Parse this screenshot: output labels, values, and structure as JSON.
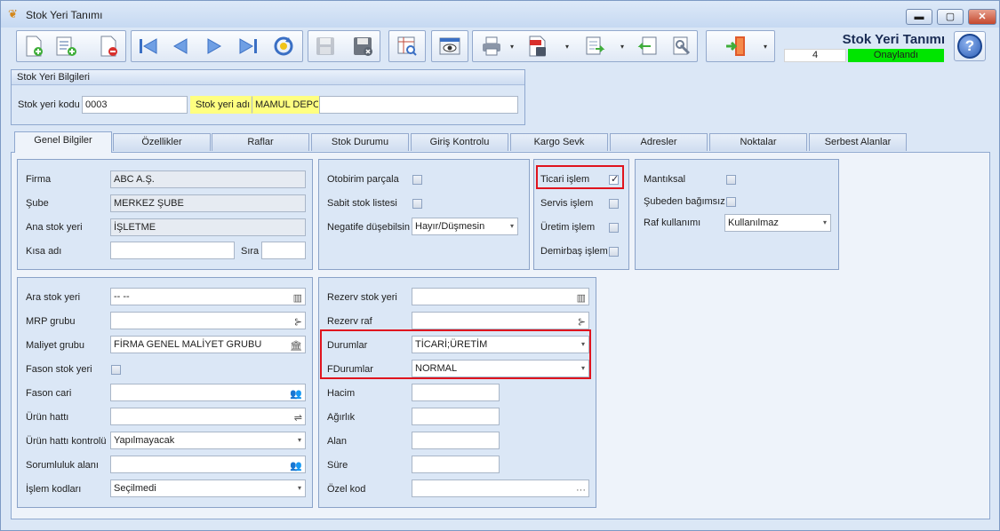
{
  "window": {
    "title": "Stok Yeri Tanımı",
    "controls": {
      "minimize": "▬",
      "maximize": "▢",
      "close": "✕"
    }
  },
  "toolbar": {
    "app_title": "Stok Yeri Tanımı",
    "record_number": "4",
    "status": "Onaylandı",
    "status_color": "#00e500",
    "help_label": "?"
  },
  "header_group": {
    "title": "Stok Yeri Bilgileri",
    "code_label": "Stok yeri kodu",
    "code_value": "0003",
    "name_label": "Stok yeri adı",
    "name_value": "MAMUL DEPO"
  },
  "tabs": [
    {
      "label": "Genel Bilgiler"
    },
    {
      "label": "Özellikler"
    },
    {
      "label": "Raflar"
    },
    {
      "label": "Stok Durumu"
    },
    {
      "label": "Giriş Kontrolu"
    },
    {
      "label": "Kargo Sevk"
    },
    {
      "label": "Adresler"
    },
    {
      "label": "Noktalar"
    },
    {
      "label": "Serbest Alanlar"
    }
  ],
  "general": {
    "firma_label": "Firma",
    "firma_value": "ABC A.Ş.",
    "sube_label": "Şube",
    "sube_value": "MERKEZ ŞUBE",
    "ana_label": "Ana stok yeri",
    "ana_value": "İŞLETME",
    "kisa_label": "Kısa adı",
    "kisa_value": "",
    "sira_label": "Sıra",
    "sira_value": ""
  },
  "flags1": {
    "otobirim_label": "Otobirim parçala",
    "sabit_label": "Sabit stok listesi",
    "negatif_label": "Negatife düşebilsin",
    "negatif_value": "Hayır/Düşmesin"
  },
  "flags2": {
    "ticari_label": "Ticari işlem",
    "ticari_checked": true,
    "servis_label": "Servis işlem",
    "uretim_label": "Üretim işlem",
    "demirbas_label": "Demirbaş işlem"
  },
  "flags3": {
    "mantiksal_label": "Mantıksal",
    "subeden_label": "Şubeden bağımsız",
    "raf_label": "Raf kullanımı",
    "raf_value": "Kullanılmaz"
  },
  "details": {
    "ara_label": "Ara stok yeri",
    "ara_value": "-- --",
    "mrp_label": "MRP grubu",
    "mrp_value": "",
    "maliyet_label": "Maliyet grubu",
    "maliyet_value": "FİRMA GENEL MALİYET GRUBU",
    "fason_label": "Fason stok yeri",
    "fasoncari_label": "Fason cari",
    "fasoncari_value": "",
    "urunhatti_label": "Ürün hattı",
    "urunhatti_value": "",
    "urunkontrol_label": "Ürün hattı kontrolü",
    "urunkontrol_value": "Yapılmayacak",
    "sorumluluk_label": "Sorumluluk alanı",
    "sorumluluk_value": "",
    "islem_label": "İşlem kodları",
    "islem_value": "Seçilmedi"
  },
  "reserve": {
    "rezervstok_label": "Rezerv stok yeri",
    "rezervstok_value": "",
    "rezervraf_label": "Rezerv raf",
    "rezervraf_value": "",
    "durumlar_label": "Durumlar",
    "durumlar_value": "TİCARİ;ÜRETİM",
    "fdurumlar_label": "FDurumlar",
    "fdurumlar_value": "NORMAL",
    "hacim_label": "Hacim",
    "hacim_value": "",
    "agirlik_label": "Ağırlık",
    "agirlik_value": "",
    "alan_label": "Alan",
    "alan_value": "",
    "sure_label": "Süre",
    "sure_value": "",
    "ozel_label": "Özel kod",
    "ozel_value": "",
    "ellipsis": "···"
  },
  "glyphs": {
    "dropdown": "▾",
    "calendar": "▥",
    "tree": "⊱",
    "bank": "🏛",
    "people": "👥",
    "line": "⇌"
  }
}
